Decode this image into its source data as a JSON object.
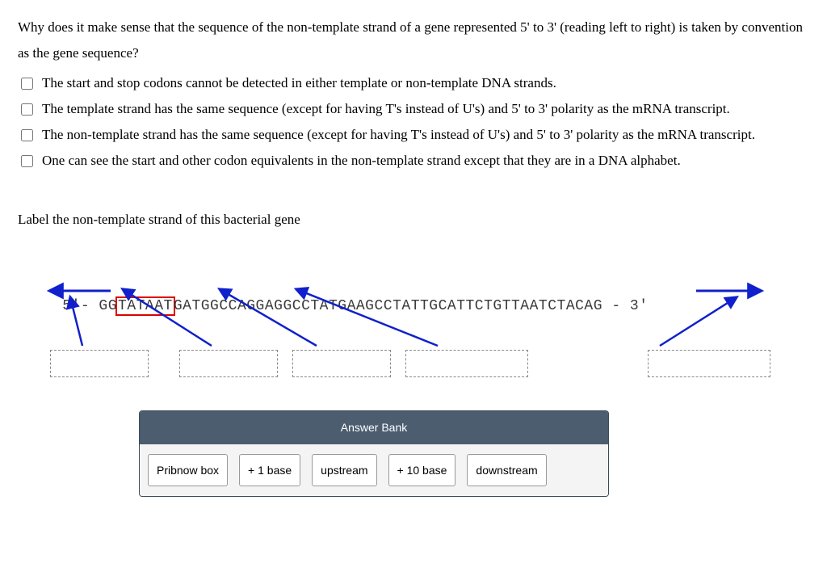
{
  "question": "Why does it make sense that the sequence of the non-template strand of a gene represented 5' to 3' (reading left to right) is taken by convention as the gene sequence?",
  "options": [
    "The start and stop codons cannot be detected in either template or non-template DNA strands.",
    "The template strand has the same sequence (except for having T's instead of U's) and 5' to 3' polarity as the mRNA transcript.",
    "The non-template strand has the same sequence (except for having T's instead of U's) and 5' to 3' polarity as the mRNA transcript.",
    "One can see the start and other codon equivalents in the non-template strand except that they are in a DNA alphabet."
  ],
  "sub_prompt": "Label the non-template strand of this bacterial gene",
  "seq": {
    "prefix": "5'- GG",
    "boxed": "TATAAT",
    "rest": "GATGGCCAGGAGGCCTATGAAGCCTATTGCATTCTGTTAATCTACAG - 3'"
  },
  "answer_bank": {
    "title": "Answer Bank",
    "chips": [
      "Pribnow box",
      "+ 1 base",
      "upstream",
      "+ 10 base",
      "downstream"
    ]
  }
}
